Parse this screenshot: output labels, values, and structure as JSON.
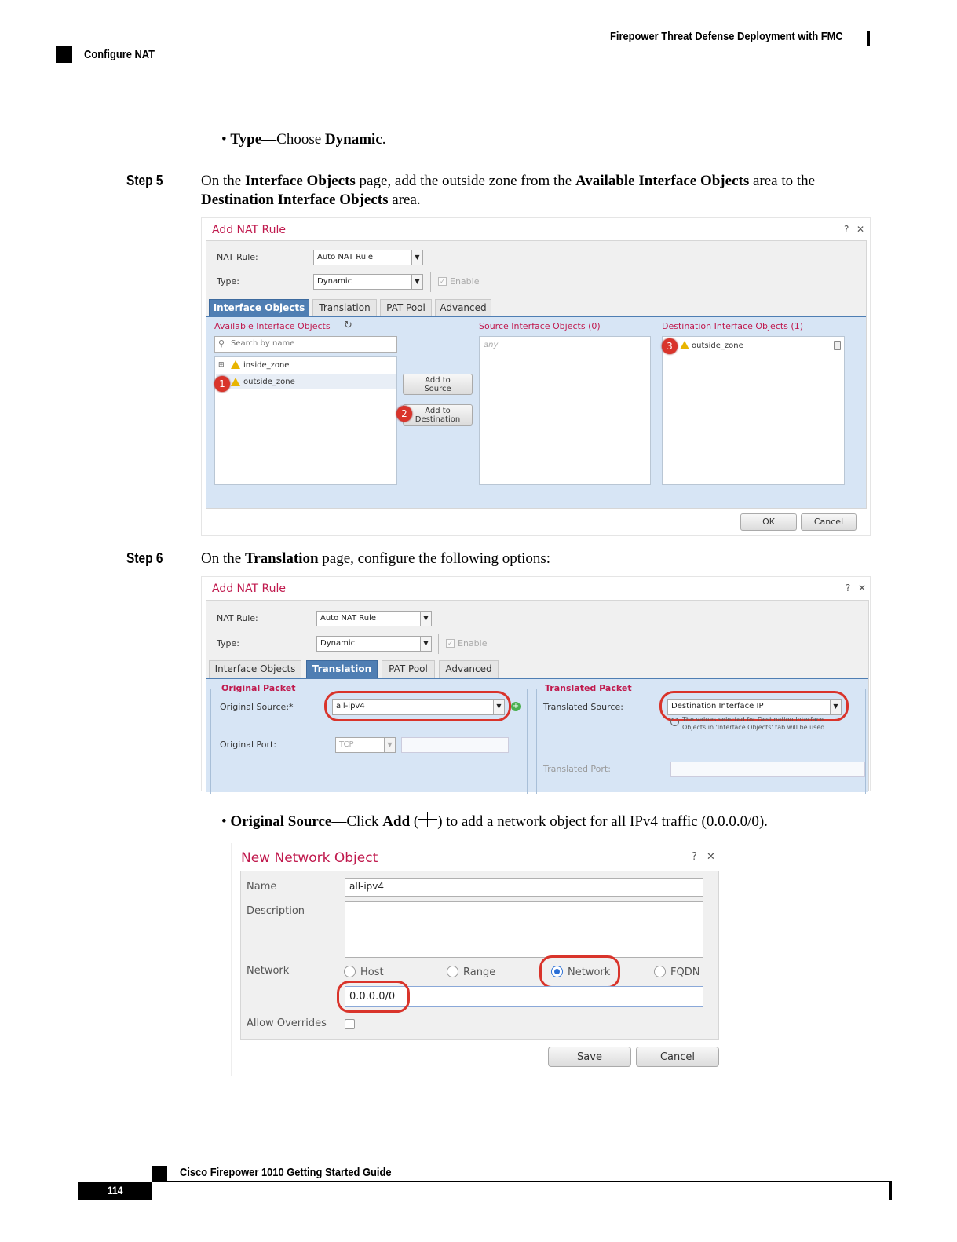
{
  "header": {
    "book_title": "Firepower Threat Defense Deployment with FMC",
    "section": "Configure NAT"
  },
  "intro_bullet": {
    "label": "Type",
    "dash": "—Choose ",
    "value": "Dynamic",
    "end": "."
  },
  "step5": {
    "label": "Step 5",
    "text_1": "On the ",
    "bold_1": "Interface Objects",
    "text_2": " page, add the outside zone from the ",
    "bold_2": "Available Interface Objects",
    "text_3": " area to the ",
    "bold_3": "Destination Interface Objects",
    "text_4": " area."
  },
  "dialog1": {
    "title": "Add NAT Rule",
    "help": "?",
    "close": "✕",
    "nat_rule_label": "NAT Rule:",
    "nat_rule_value": "Auto NAT Rule",
    "type_label": "Type:",
    "type_value": "Dynamic",
    "enable_label": "Enable",
    "tabs": [
      "Interface Objects",
      "Translation",
      "PAT Pool",
      "Advanced"
    ],
    "available_title": "Available Interface Objects",
    "search_placeholder": "Search by name",
    "available_items": [
      "inside_zone",
      "outside_zone"
    ],
    "add_to_source": [
      "Add to",
      "Source"
    ],
    "add_to_destination": [
      "Add to",
      "Destination"
    ],
    "source_title": "Source Interface Objects (0)",
    "source_placeholder": "any",
    "destination_title": "Destination Interface Objects (1)",
    "destination_items": [
      "outside_zone"
    ],
    "badges": [
      "1",
      "2",
      "3"
    ],
    "ok": "OK",
    "cancel": "Cancel"
  },
  "step6": {
    "label": "Step 6",
    "text_1": "On the ",
    "bold_1": "Translation",
    "text_2": " page, configure the following options:"
  },
  "dialog2": {
    "title": "Add NAT Rule",
    "help": "?",
    "close": "✕",
    "nat_rule_label": "NAT Rule:",
    "nat_rule_value": "Auto NAT Rule",
    "type_label": "Type:",
    "type_value": "Dynamic",
    "enable_label": "Enable",
    "tabs": [
      "Interface Objects",
      "Translation",
      "PAT Pool",
      "Advanced"
    ],
    "original_packet": "Original Packet",
    "original_source_label": "Original Source:*",
    "original_source_value": "all-ipv4",
    "original_port_label": "Original Port:",
    "original_port_value": "TCP",
    "translated_packet": "Translated Packet",
    "translated_source_label": "Translated Source:",
    "translated_source_value": "Destination Interface IP",
    "translated_note": "The values selected for Destination Interface Objects in 'Interface Objects' tab will be used",
    "translated_port_label": "Translated Port:"
  },
  "bullet2": {
    "label": "Original Source",
    "text_1": "—Click ",
    "bold_add": "Add",
    "text_2": " (",
    "text_3": ") to add a network object for all IPv4 traffic (0.0.0.0/0)."
  },
  "dialog3": {
    "title": "New Network Object",
    "help": "?",
    "close": "✕",
    "name_label": "Name",
    "name_value": "all-ipv4",
    "description_label": "Description",
    "network_label": "Network",
    "radio_host": "Host",
    "radio_range": "Range",
    "radio_network": "Network",
    "radio_fqdn": "FQDN",
    "network_value": "0.0.0.0/0",
    "allow_overrides_label": "Allow Overrides",
    "save": "Save",
    "cancel": "Cancel"
  },
  "footer": {
    "guide_title": "Cisco Firepower 1010 Getting Started Guide",
    "page_number": "114"
  }
}
